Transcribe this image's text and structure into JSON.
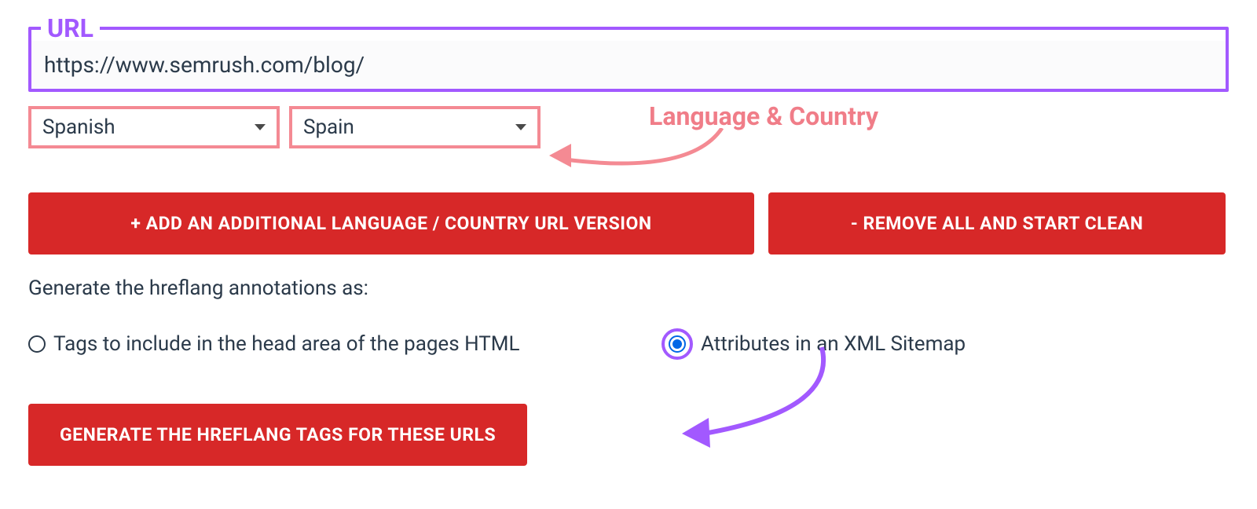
{
  "url_field": {
    "legend": "URL",
    "value": "https://www.semrush.com/blog/"
  },
  "language_select": {
    "value": "Spanish"
  },
  "country_select": {
    "value": "Spain"
  },
  "annotation": {
    "lang_country": "Language & Country"
  },
  "buttons": {
    "add": "+ ADD AN ADDITIONAL LANGUAGE / COUNTRY URL VERSION",
    "remove": "- REMOVE ALL AND START CLEAN",
    "generate": "GENERATE THE HREFLANG TAGS FOR THESE URLS"
  },
  "generate_label": "Generate the hreflang annotations as:",
  "radio": {
    "option1": "Tags to include in the head area of the pages HTML",
    "option2": "Attributes in an XML Sitemap",
    "selected": "option2"
  },
  "colors": {
    "purple": "#a259ff",
    "pink": "#f48a93",
    "red": "#d72828"
  }
}
